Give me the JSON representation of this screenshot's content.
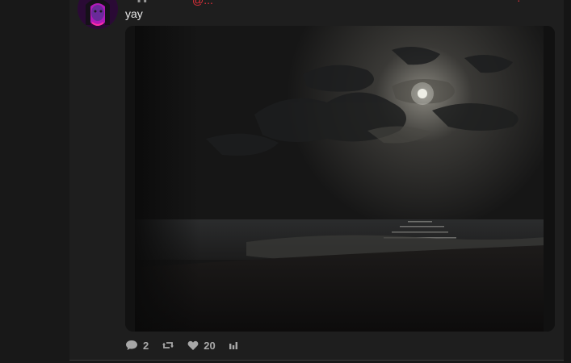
{
  "post": {
    "text": "yay",
    "header_icons": "▪ ▪",
    "header_red_left": "@...",
    "header_red_right": "·",
    "actions": {
      "replies_count": "2",
      "likes_count": "20"
    },
    "icons": {
      "reply": "comment-icon",
      "repost": "repost-icon",
      "like": "heart-icon",
      "stats": "bar-chart-icon"
    },
    "colors": {
      "accent_red": "#e0303a",
      "background": "#181818",
      "card": "#1e1e1e"
    }
  }
}
